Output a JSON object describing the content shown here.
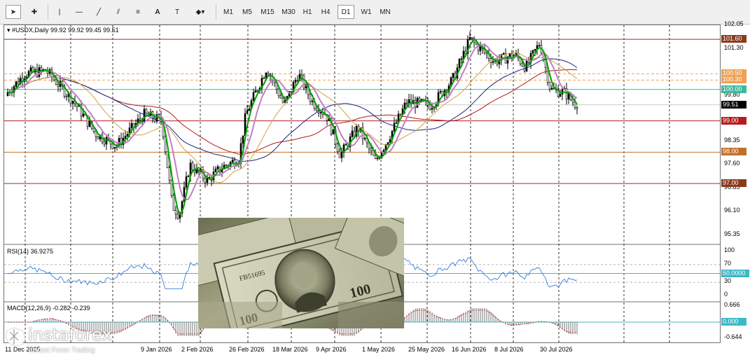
{
  "toolbar": {
    "tools": [
      {
        "name": "cursor-icon",
        "glyph": "➤"
      },
      {
        "name": "crosshair-icon",
        "glyph": "✚"
      },
      {
        "name": "vertical-line-icon",
        "glyph": "|"
      },
      {
        "name": "horizontal-line-icon",
        "glyph": "—"
      },
      {
        "name": "trendline-icon",
        "glyph": "╱"
      },
      {
        "name": "channel-icon",
        "glyph": "⫽"
      },
      {
        "name": "fibonacci-icon",
        "glyph": "≡"
      },
      {
        "name": "text-icon",
        "glyph": "A"
      },
      {
        "name": "text-label-icon",
        "glyph": "T"
      },
      {
        "name": "shapes-icon",
        "glyph": "◆▾"
      }
    ],
    "timeframes": [
      "M1",
      "M5",
      "M15",
      "M30",
      "H1",
      "H4",
      "D1",
      "W1",
      "MN"
    ],
    "active_timeframe": "D1"
  },
  "chart": {
    "header": "#USDX,Daily  99.92 99.92 99.45 99.51",
    "current_price": "99.51",
    "price_labels": [
      "102.05",
      "101.30",
      "99.80",
      "98.35",
      "97.60",
      "96.85",
      "96.10",
      "95.35"
    ],
    "level_tags": [
      {
        "value": "101.60",
        "color": "#8b3a1c"
      },
      {
        "value": "100.50",
        "color": "#f0a050"
      },
      {
        "value": "100.30",
        "color": "#f0a050"
      },
      {
        "value": "100.00",
        "color": "#3cb89b"
      },
      {
        "value": "99.00",
        "color": "#b71c1c"
      },
      {
        "value": "98.00",
        "color": "#c1702a"
      },
      {
        "value": "97.00",
        "color": "#8b3a1c"
      }
    ],
    "date_labels": [
      "9 Jan 2026",
      "2 Feb 2026",
      "26 Feb 2026",
      "18 Mar 2026",
      "9 Apr 2026",
      "1 May 2026",
      "25 May 2026",
      "16 Jun 2026",
      "8 Jul 2026",
      "30 Jul 2026"
    ],
    "first_date_partial": "11 Dec 2025"
  },
  "rsi": {
    "label": "RSI(14) 36.9275",
    "axis": [
      "100",
      "70",
      "30",
      "0"
    ],
    "level_tag": "50.0000"
  },
  "macd": {
    "label": "MACD(12,26,9) -0.282 -0.239",
    "axis": [
      "0.666",
      "-0.644"
    ],
    "zero_tag": "0.000"
  },
  "branding": {
    "logo": "instaforex",
    "tagline": "Instant Forex Trading"
  },
  "colors": {
    "bull_candle": "#006400",
    "ma_fast": "#00a000",
    "ma_mid": "#c080c0",
    "ma_slow": "#d4a040",
    "ma_200": "#b01818",
    "ma_navy": "#1a237e",
    "rsi_line": "#1e6fd9",
    "macd_signal": "#c62828"
  }
}
